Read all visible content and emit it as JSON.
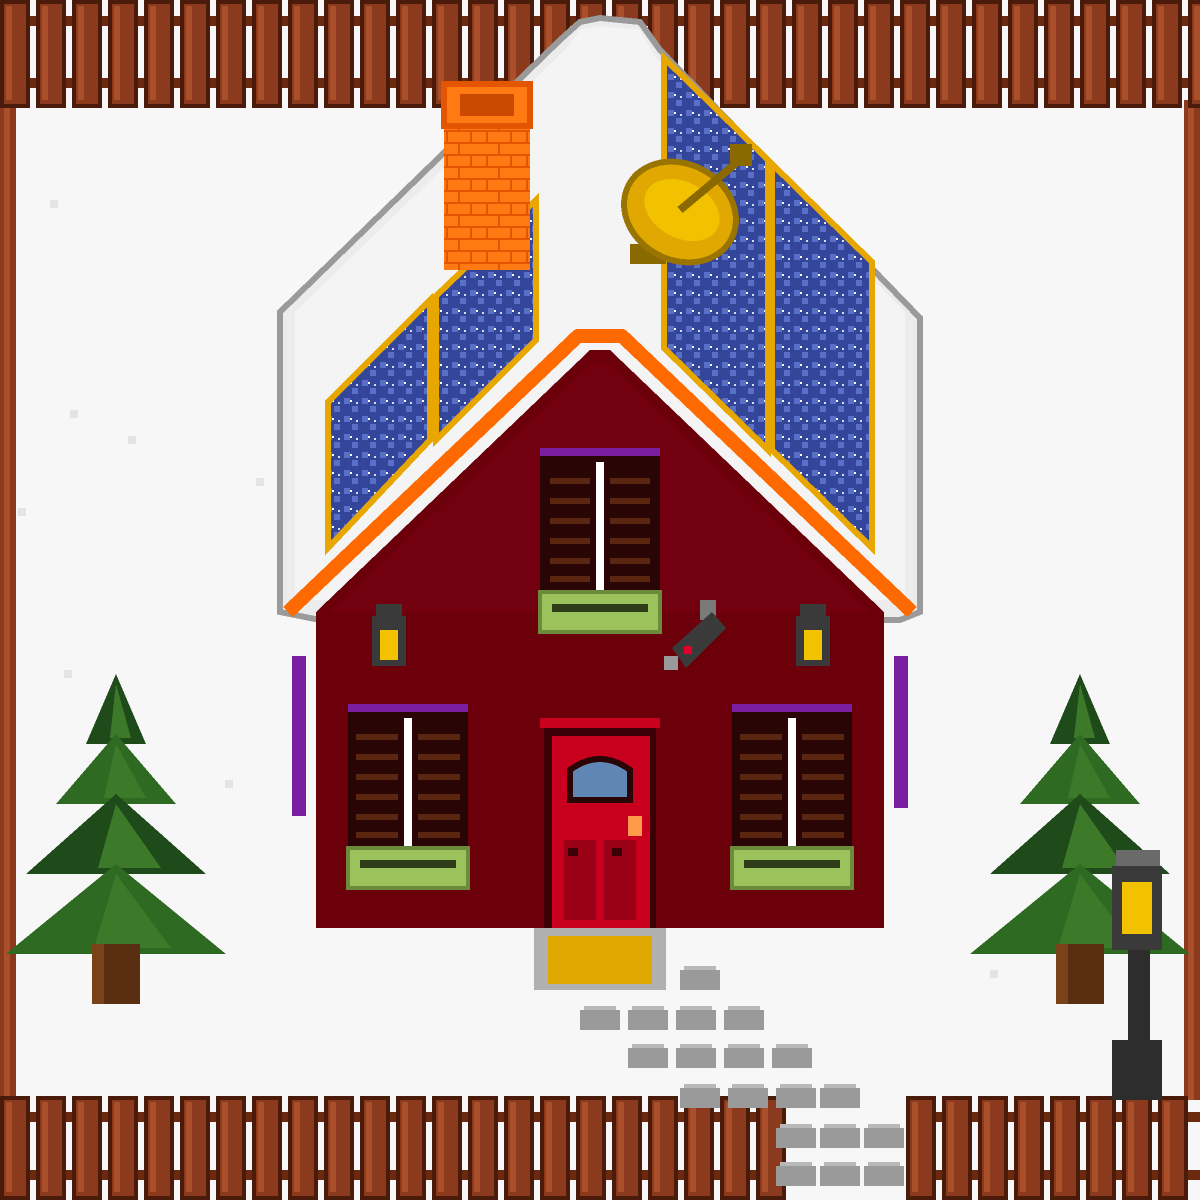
{
  "scene": {
    "type": "pixel-art",
    "subject": "snowy cottage",
    "season": "winter"
  },
  "colors": {
    "snow": "#f7f7f7",
    "fence": "#8b3a1e",
    "fence_dark": "#4a1a0a",
    "fence_light": "#a9502b",
    "house_wall": "#6b000b",
    "house_trim": "#ff6a00",
    "roof_snow": "#eeeeee",
    "solar_panel": "#3a4d9e",
    "solar_frame": "#e7a600",
    "chimney": "#ff7a12",
    "door": "#c8001e",
    "doormat": "#e0a800",
    "shutter": "#2a0505",
    "flower_box": "#9cc25b",
    "window_frame": "#7a1ea0",
    "tree_dark": "#1f4a1a",
    "tree_light": "#3c7a2a",
    "trunk": "#5a2e10",
    "stepping_stone": "#9a9a9a",
    "lamp_post": "#2d2d2d",
    "lamp_light": "#f2c200"
  }
}
